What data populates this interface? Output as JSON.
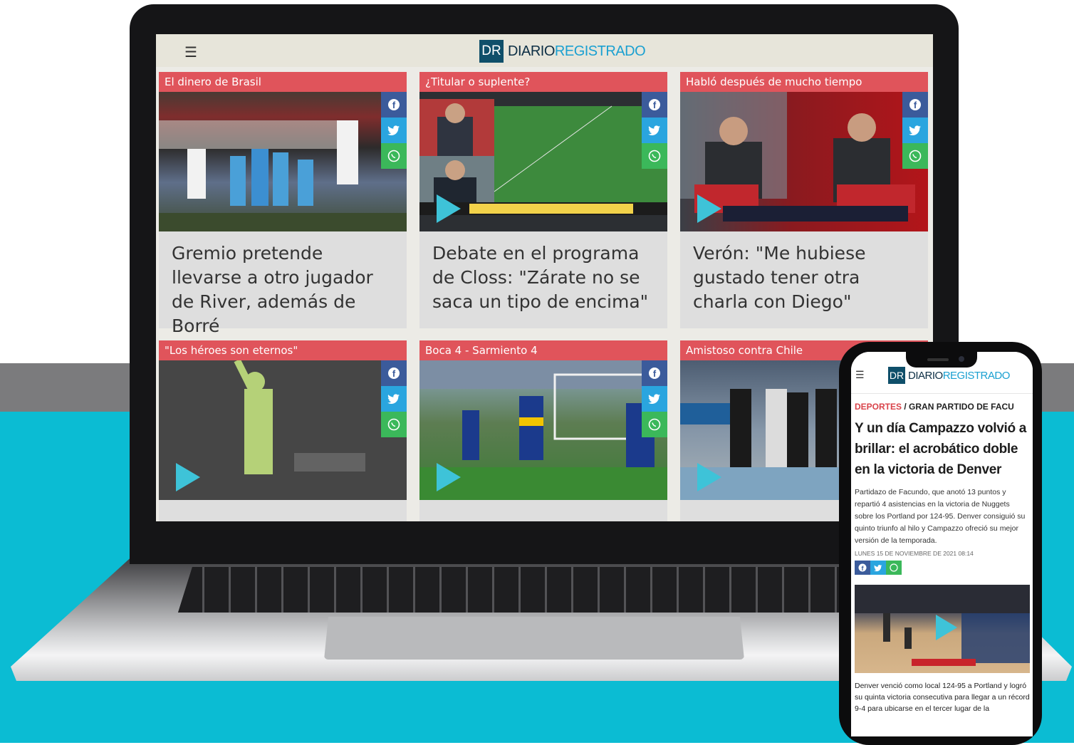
{
  "site": {
    "logo_mark": "DR",
    "logo_text_a": "DIARIO",
    "logo_text_b": "REGISTRADO",
    "menu_icon": "hamburger-icon",
    "colors": {
      "brand_dark": "#0f4f6a",
      "brand_blue": "#1aa0d1",
      "kicker_red": "#e0545b",
      "bg_cyan": "#0bbcd3"
    }
  },
  "cards": [
    {
      "kicker": "El dinero de Brasil",
      "headline": "Gremio pretende llevarse a otro jugador de River, además de Borré",
      "has_video": false
    },
    {
      "kicker": "¿Titular o suplente?",
      "headline": "Debate en el programa de Closs: \"Zárate no se saca un tipo de encima\"",
      "has_video": true
    },
    {
      "kicker": "Habló después de mucho tiempo",
      "headline": "Verón: \"Me hubiese gustado tener otra charla con Diego\"",
      "has_video": true
    },
    {
      "kicker": "\"Los héroes son eternos\"",
      "headline": "",
      "has_video": true
    },
    {
      "kicker": "Boca 4 - Sarmiento 4",
      "headline": "",
      "has_video": true
    },
    {
      "kicker": "Amistoso contra Chile",
      "headline": "",
      "has_video": true
    }
  ],
  "share_icons": [
    "facebook-icon",
    "twitter-icon",
    "whatsapp-icon"
  ],
  "phone": {
    "section": "DEPORTES",
    "separator": " / ",
    "subsection": "GRAN PARTIDO DE FACU",
    "title": "Y un día Campazzo volvió a brillar: el acrobático doble en la victoria de Denver",
    "lead": "Partidazo de Facundo, que anotó 13 puntos y repartió 4 asistencias en la victoria de Nuggets sobre los Portland por 124-95. Denver consiguió su quinto triunfo al hilo y Campazzo ofreció su mejor versión de la temporada.",
    "date": "LUNES 15 DE NOVIEMBRE DE 2021 08:14",
    "body": "Denver venció como local 124-95 a Portland y logró su quinta victoria consecutiva para llegar a un récord 9-4 para ubicarse en el tercer lugar de la"
  }
}
